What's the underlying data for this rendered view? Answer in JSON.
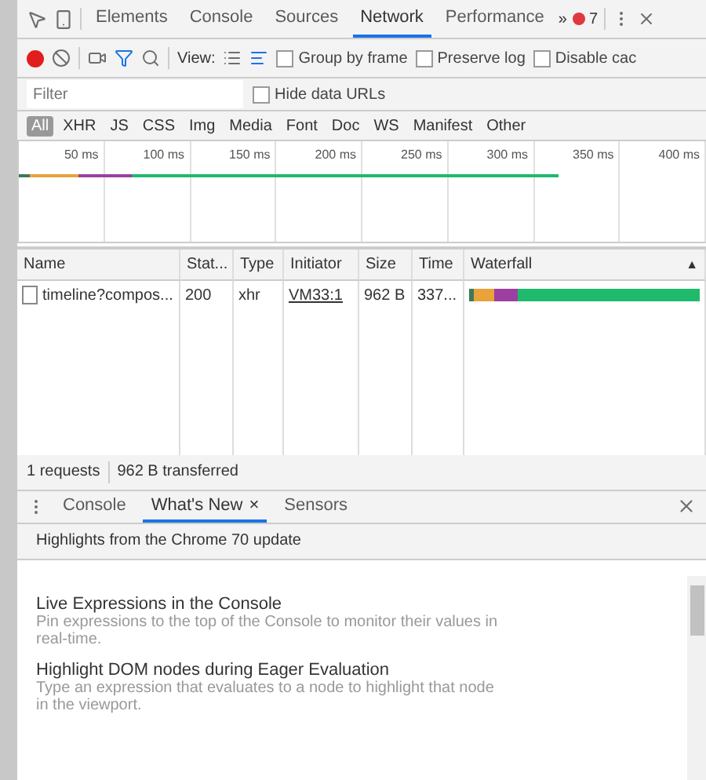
{
  "main_tabs": [
    {
      "label": "Elements",
      "selected": false
    },
    {
      "label": "Console",
      "selected": false
    },
    {
      "label": "Sources",
      "selected": false
    },
    {
      "label": "Network",
      "selected": true
    },
    {
      "label": "Performance",
      "selected": false
    }
  ],
  "more_tabs": "»",
  "error_count": "7",
  "toolbar": {
    "recording": true,
    "filter_on": true,
    "view_label": "View:",
    "options": [
      {
        "label": "Group by frame",
        "checked": false
      },
      {
        "label": "Preserve log",
        "checked": false
      },
      {
        "label": "Disable cac",
        "checked": false
      }
    ]
  },
  "filter": {
    "placeholder": "Filter",
    "hide_data_urls": {
      "label": "Hide data URLs",
      "checked": false
    }
  },
  "types": [
    {
      "label": "All",
      "selected": true
    },
    {
      "label": "XHR",
      "selected": false
    },
    {
      "label": "JS",
      "selected": false
    },
    {
      "label": "CSS",
      "selected": false
    },
    {
      "label": "Img",
      "selected": false
    },
    {
      "label": "Media",
      "selected": false
    },
    {
      "label": "Font",
      "selected": false
    },
    {
      "label": "Doc",
      "selected": false
    },
    {
      "label": "WS",
      "selected": false
    },
    {
      "label": "Manifest",
      "selected": false
    },
    {
      "label": "Other",
      "selected": false
    }
  ],
  "overview_ticks": [
    "50 ms",
    "100 ms",
    "150 ms",
    "200 ms",
    "250 ms",
    "300 ms",
    "350 ms",
    "400 ms"
  ],
  "table": {
    "columns": [
      "Name",
      "Stat...",
      "Type",
      "Initiator",
      "Size",
      "Time",
      "Waterfall"
    ],
    "sort_mark": "▲",
    "rows": [
      {
        "name": "timeline?compos...",
        "status": "200",
        "type": "xhr",
        "initiator": "VM33:1",
        "size": "962 B",
        "time": "337..."
      }
    ]
  },
  "status_bar": {
    "requests": "1 requests",
    "transferred": "962 B transferred"
  },
  "drawer": {
    "tabs": [
      {
        "label": "Console",
        "selected": false,
        "closable": false
      },
      {
        "label": "What's New",
        "selected": true,
        "closable": true
      },
      {
        "label": "Sensors",
        "selected": false,
        "closable": false
      }
    ],
    "close_mark": "×",
    "banner": "Highlights from the Chrome 70 update",
    "items": [
      {
        "title": "Live Expressions in the Console",
        "text": "Pin expressions to the top of the Console to monitor their values in real-time."
      },
      {
        "title": "Highlight DOM nodes during Eager Evaluation",
        "text": "Type an expression that evaluates to a node to highlight that node in the viewport."
      }
    ]
  }
}
